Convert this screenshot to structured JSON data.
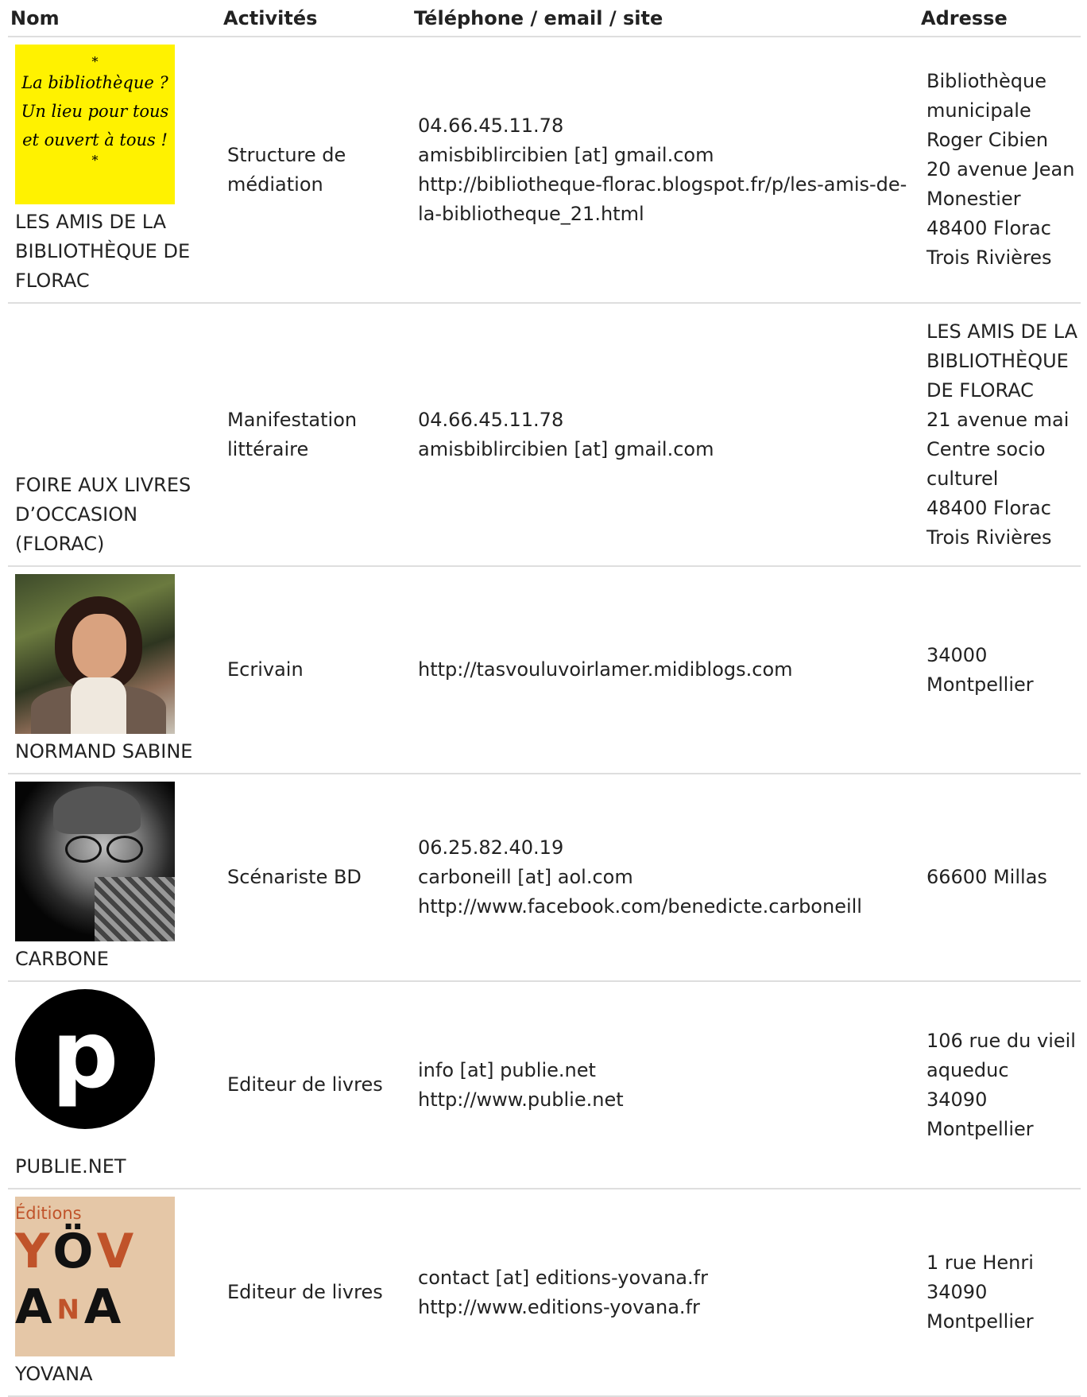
{
  "columns": {
    "nom": "Nom",
    "activites": "Activités",
    "contact": "Téléphone / email / site",
    "adresse": "Adresse"
  },
  "rows": [
    {
      "thumb": {
        "type": "poster",
        "line1": "*",
        "line2": "La bibliothèque ?",
        "line3": "Un lieu pour tous",
        "line4": "et ouvert à tous !",
        "line5": "*"
      },
      "nom": [
        "LES AMIS DE LA",
        "BIBLIOTHÈQUE DE",
        "FLORAC"
      ],
      "activite": [
        "Structure de",
        "médiation"
      ],
      "contact": [
        "04.66.45.11.78",
        "amisbiblircibien [at] gmail.com",
        "http://bibliotheque-florac.blogspot.fr/p/les-amis-de-",
        "la-bibliotheque_21.html"
      ],
      "adresse": [
        "Bibliothèque",
        "municipale",
        "Roger Cibien",
        "20 avenue Jean",
        "Monestier",
        "48400 Florac",
        "Trois Rivières"
      ]
    },
    {
      "thumb": null,
      "nom": [
        "FOIRE AUX LIVRES",
        "D’OCCASION",
        "(FLORAC)"
      ],
      "activite": [
        "Manifestation",
        "littéraire"
      ],
      "contact": [
        "04.66.45.11.78",
        "amisbiblircibien [at] gmail.com"
      ],
      "adresse": [
        "LES AMIS DE LA",
        "BIBLIOTHÈQUE",
        "DE FLORAC",
        "21 avenue mai",
        "Centre socio",
        "culturel",
        "48400 Florac",
        "Trois Rivières"
      ]
    },
    {
      "thumb": {
        "type": "photo-woman"
      },
      "nom": [
        "NORMAND SABINE"
      ],
      "activite": [
        "Ecrivain"
      ],
      "contact": [
        "http://tasvouluvoirlamer.midiblogs.com"
      ],
      "adresse": [
        "34000",
        "Montpellier"
      ]
    },
    {
      "thumb": {
        "type": "photo-man"
      },
      "nom": [
        "CARBONE"
      ],
      "activite": [
        "Scénariste BD"
      ],
      "contact": [
        "06.25.82.40.19",
        "carboneill [at] aol.com",
        "http://www.facebook.com/benedicte.carboneill"
      ],
      "adresse": [
        "66600 Millas"
      ]
    },
    {
      "thumb": {
        "type": "publie",
        "letter": "p"
      },
      "nom": [
        "PUBLIE.NET"
      ],
      "activite": [
        "Editeur de livres"
      ],
      "contact": [
        "info [at] publie.net",
        "http://www.publie.net"
      ],
      "adresse": [
        "106 rue du vieil",
        "aqueduc",
        "34090",
        "Montpellier"
      ]
    },
    {
      "thumb": {
        "type": "yovana",
        "ed": "Éditions",
        "l1a": "Y",
        "l1b": "Ö",
        "l1c": "V",
        "l2a": "A",
        "l2b": "N",
        "l2c": "A"
      },
      "nom": [
        "YOVANA"
      ],
      "activite": [
        "Editeur de livres"
      ],
      "contact": [
        "contact [at] editions-yovana.fr",
        "http://www.editions-yovana.fr"
      ],
      "adresse": [
        "1 rue Henri",
        "34090",
        "Montpellier"
      ]
    }
  ]
}
